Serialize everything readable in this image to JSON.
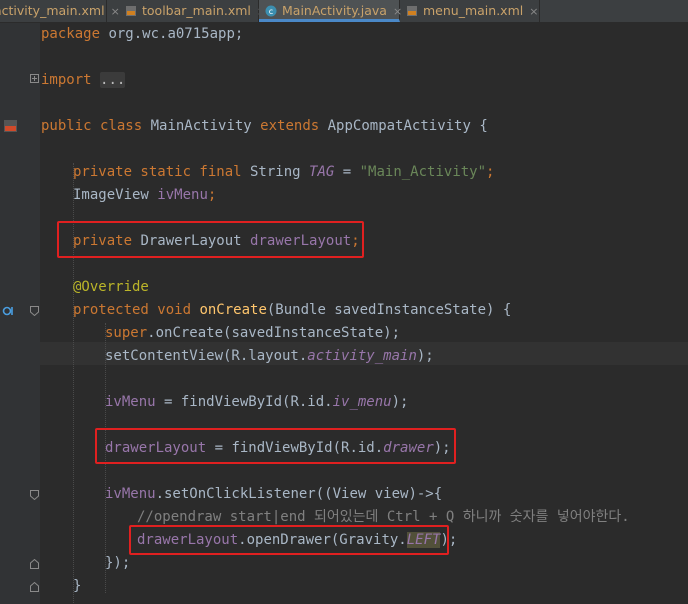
{
  "tabs": [
    {
      "label": "activity_main.xml",
      "active": false
    },
    {
      "label": "toolbar_main.xml",
      "active": false
    },
    {
      "label": "MainActivity.java",
      "active": true
    },
    {
      "label": "menu_main.xml",
      "active": false
    }
  ],
  "tab_close": "×",
  "code": {
    "package_kw": "package",
    "package_name": " org.wc.a0715app;",
    "import_kw": "import",
    "import_fold": "...",
    "l3": {
      "k1": "public",
      "k2": " class",
      "name": " MainActivity ",
      "k3": "extends",
      "rest": " AppCompatActivity {"
    },
    "l4": {
      "k": "private static final",
      "type": " String ",
      "field": "TAG",
      "eq": " = ",
      "str": "\"Main_Activity\"",
      "semi": ";"
    },
    "l5": {
      "type": "ImageView ",
      "field": "ivMenu",
      "semi": ";"
    },
    "l6": {
      "k": "private",
      "type": " DrawerLayout ",
      "field": "drawerLayout",
      "semi": ";"
    },
    "l7": {
      "ann": "@Override"
    },
    "l8": {
      "k": "protected void ",
      "fn": "onCreate",
      "rest": "(Bundle savedInstanceState) {"
    },
    "l9": {
      "k": "super",
      "rest": ".onCreate(savedInstanceState);"
    },
    "l10": {
      "a": "setContentView(R.layout.",
      "f": "activity_main",
      "b": ");"
    },
    "l11": {
      "f": "ivMenu",
      "a": " = findViewById(R.id.",
      "f2": "iv_menu",
      "b": ");"
    },
    "l12": {
      "f": "drawerLayout",
      "a": " = findViewById(R.id.",
      "f2": "drawer",
      "b": ");"
    },
    "l13": {
      "f": "ivMenu",
      "a": ".setOnClickListener((View view)->{"
    },
    "l14": {
      "c": "//opendraw start|end 되어있는데 Ctrl + Q 하니까 숫자를 넣어야한다."
    },
    "l15": {
      "f": "drawerLayout",
      "a": ".openDrawer(Gravity.",
      "f2": "LEFT",
      "b": ");"
    },
    "l16": {
      "a": "});"
    },
    "l17": {
      "a": "}"
    }
  },
  "colors": {
    "keyword": "#cc7832",
    "string": "#6a8759",
    "field": "#9876aa",
    "annotation": "#bbb529",
    "method": "#ffc66d",
    "comment": "#808080",
    "highlight_box": "#e02020"
  },
  "icons": [
    "xml-file-icon",
    "class-file-icon",
    "class-marker-icon",
    "override-marker-icon",
    "fold-icon"
  ]
}
